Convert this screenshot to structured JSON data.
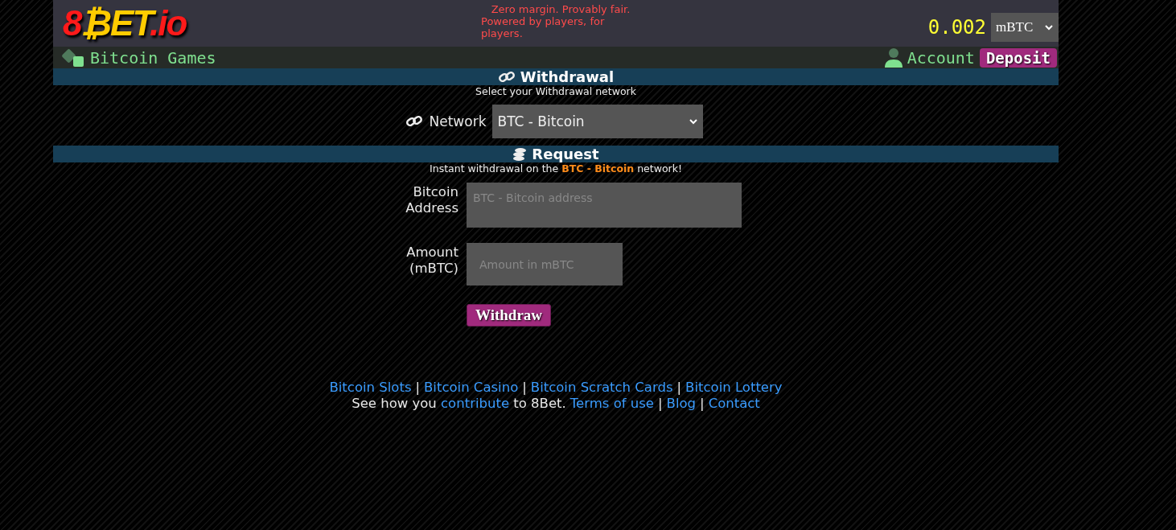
{
  "logo": {
    "parts": [
      {
        "text": "8",
        "color": "#ff1a1a"
      },
      {
        "text": "₿ET",
        "color": "#ffcc00"
      },
      {
        "text": ".io",
        "color": "#ff1a1a"
      }
    ]
  },
  "tagline": [
    "Zero margin. Provably fair.",
    "Powered by players, for players."
  ],
  "balance": {
    "amount": "0.002",
    "unit": "mBTC"
  },
  "nav": {
    "games": "Bitcoin Games",
    "account": "Account",
    "deposit": "Deposit"
  },
  "withdrawal": {
    "title": "Withdrawal",
    "subtitle": "Select your Withdrawal network",
    "network_label": "Network",
    "network_value": "BTC - Bitcoin"
  },
  "request": {
    "title": "Request",
    "note": "Instant withdrawal on the **BTC - Bitcoin** network!",
    "fields": [
      {
        "label": "Bitcoin Address",
        "placeholder": "BTC - Bitcoin address",
        "kind": "wide"
      },
      {
        "label": "Amount (mBTC)",
        "placeholder": "Amount in mBTC",
        "kind": "narrow"
      }
    ],
    "button": "Withdraw"
  },
  "footer": {
    "links": [
      "Bitcoin Slots",
      "Bitcoin Casino",
      "Bitcoin Scratch Cards",
      "Bitcoin Lottery"
    ],
    "separator": "|",
    "sentence": {
      "before": "See how you",
      "link": "contribute",
      "after": "to 8Bet."
    },
    "more_links": [
      "Terms of use",
      "Blog",
      "Contact"
    ]
  }
}
